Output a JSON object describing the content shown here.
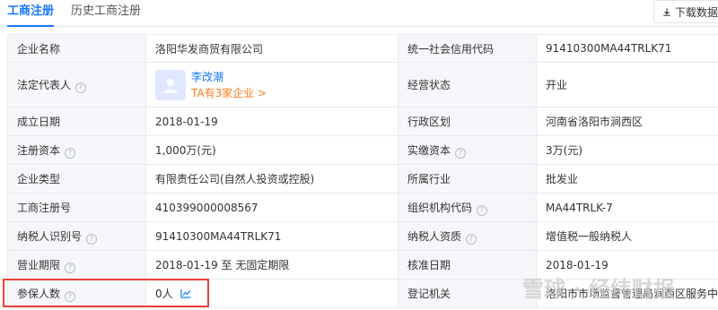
{
  "tabs": {
    "active": "工商注册",
    "inactive": "历史工商注册"
  },
  "download_label": "下载数据",
  "rows": [
    {
      "l1": "企业名称",
      "v1": "洛阳华发商贸有限公司",
      "l2": "统一社会信用代码",
      "v2": "91410300MA44TRLK71"
    },
    {
      "l1": "法定代表人",
      "rep_name": "李改潮",
      "rep_sub": "TA有3家企业 >",
      "l2": "经营状态",
      "v2": "开业"
    },
    {
      "l1": "成立日期",
      "v1": "2018-01-19",
      "l2": "行政区划",
      "v2": "河南省洛阳市涧西区"
    },
    {
      "l1": "注册资本",
      "v1": "1,000万(元)",
      "l2": "实缴资本",
      "v2": "3万(元)"
    },
    {
      "l1": "企业类型",
      "v1": "有限责任公司(自然人投资或控股)",
      "l2": "所属行业",
      "v2": "批发业"
    },
    {
      "l1": "工商注册号",
      "v1": "410399000008567",
      "l2": "组织机构代码",
      "v2": "MA44TRLK-7"
    },
    {
      "l1": "纳税人识别号",
      "v1": "91410300MA44TRLK71",
      "l2": "纳税人资质",
      "v2": "增值税一般纳税人"
    },
    {
      "l1": "营业期限",
      "v1": "2018-01-19 至 无固定期限",
      "l2": "核准日期",
      "v2": "2018-01-19"
    },
    {
      "l1": "参保人数",
      "v1": "0人",
      "l2": "登记机关",
      "v2": "洛阳市市场监督管理局涧西区服务中心"
    }
  ],
  "watermark": "雪球 · 经纬财报",
  "colors": {
    "accent": "#1677ff",
    "highlight": "#e8403a",
    "orange": "#ff7a1a"
  },
  "icons": {
    "help": "question-circle-icon",
    "download": "download-icon",
    "trend": "line-chart-icon"
  }
}
